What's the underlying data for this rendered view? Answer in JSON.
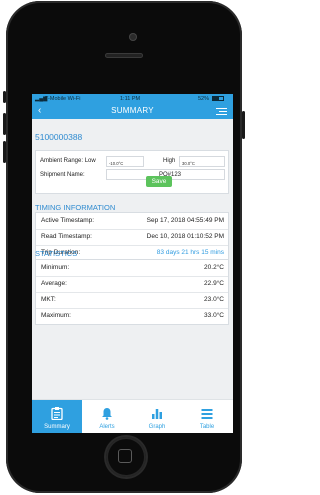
{
  "status": {
    "carrier": "T-Mobile Wi-Fi",
    "time": "1:11 PM",
    "battery": "52%"
  },
  "header": {
    "title": "SUMMARY"
  },
  "shipment": {
    "id": "5100000388",
    "ambient_label": "Ambient Range: Low",
    "low_value": "-10.0°C",
    "high_label": "High",
    "high_value": "30.0°C",
    "name_label": "Shipment Name:",
    "name_value": "PO#123",
    "save_label": "Save"
  },
  "timing": {
    "title": "TIMING INFORMATION",
    "rows": [
      {
        "label": "Active Timestamp:",
        "value": "Sep 17, 2018 04:55:49 PM"
      },
      {
        "label": "Read Timestamp:",
        "value": "Dec 10, 2018 01:10:52 PM"
      },
      {
        "label": "Trip Duration:",
        "value": "83 days 21 hrs 15 mins"
      }
    ]
  },
  "stats": {
    "title": "STATISTICS",
    "rows": [
      {
        "label": "Minimum:",
        "value": "20.2°C"
      },
      {
        "label": "Average:",
        "value": "22.9°C"
      },
      {
        "label": "MKT:",
        "value": "23.0°C"
      },
      {
        "label": "Maximum:",
        "value": "33.0°C"
      }
    ]
  },
  "tabs": [
    {
      "label": "Summary",
      "icon": "clipboard-icon"
    },
    {
      "label": "Alerts",
      "icon": "bell-icon"
    },
    {
      "label": "Graph",
      "icon": "bar-chart-icon"
    },
    {
      "label": "Table",
      "icon": "list-icon"
    }
  ],
  "colors": {
    "accent": "#2fa0e0",
    "save": "#5cc35c",
    "link": "#2f8bd0"
  }
}
